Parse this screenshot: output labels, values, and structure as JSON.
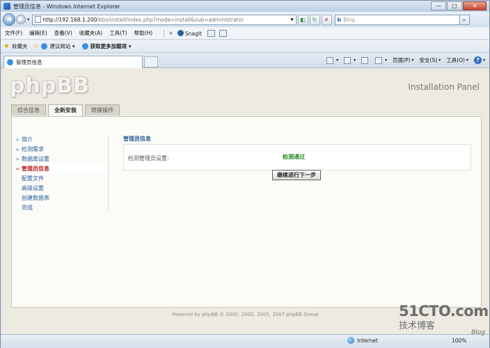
{
  "window": {
    "title": "管理员信息 - Windows Internet Explorer",
    "buttons": {
      "minimize": "—",
      "maximize": "□",
      "close": "✕"
    }
  },
  "address": {
    "url_host": "http://192.168.1.200",
    "url_path": "/bbs/install/index.php?mode=install&sub=administrator",
    "search_placeholder": "Bing"
  },
  "menu": {
    "items": [
      "文件(F)",
      "编辑(E)",
      "查看(V)",
      "收藏夹(A)",
      "工具(T)",
      "帮助(H)"
    ],
    "snagit": "SnagIt"
  },
  "favorites": {
    "label": "收藏夹",
    "items": [
      "建议网站 ▾",
      "获取更多加载项 ▾"
    ]
  },
  "tabs": {
    "active_title": "管理员信息"
  },
  "commandbar": {
    "page": "页面(P)",
    "safety": "安全(S)",
    "tools": "工具(O)"
  },
  "phpbb": {
    "logo": "phpBB",
    "panel_title": "Installation Panel",
    "nav_tabs": [
      "综合信息",
      "全新安装",
      "转换操作"
    ],
    "active_nav_tab": "全新安装",
    "steps": [
      "简介",
      "检测需求",
      "数据库设置",
      "管理员信息",
      "配置文件",
      "高级设置",
      "创建数据表",
      "完成"
    ],
    "active_step": "管理员信息",
    "section_title": "管理员信息",
    "field_label": "检测管理员设置:",
    "field_value": "检测通过",
    "continue_button": "继续进行下一步",
    "footer": "Powered by phpBB © 2000, 2002, 2005, 2007 phpBB Group"
  },
  "status": {
    "zone": "Internet",
    "zoom": "100%"
  },
  "watermark": {
    "site": "51CTO.com",
    "sub": "技术博客",
    "blog": "Blog"
  },
  "colors": {
    "link_blue": "#2c5c98",
    "active_red": "#b41e1e",
    "success_green": "#258b25",
    "page_bg": "#eceae1"
  }
}
